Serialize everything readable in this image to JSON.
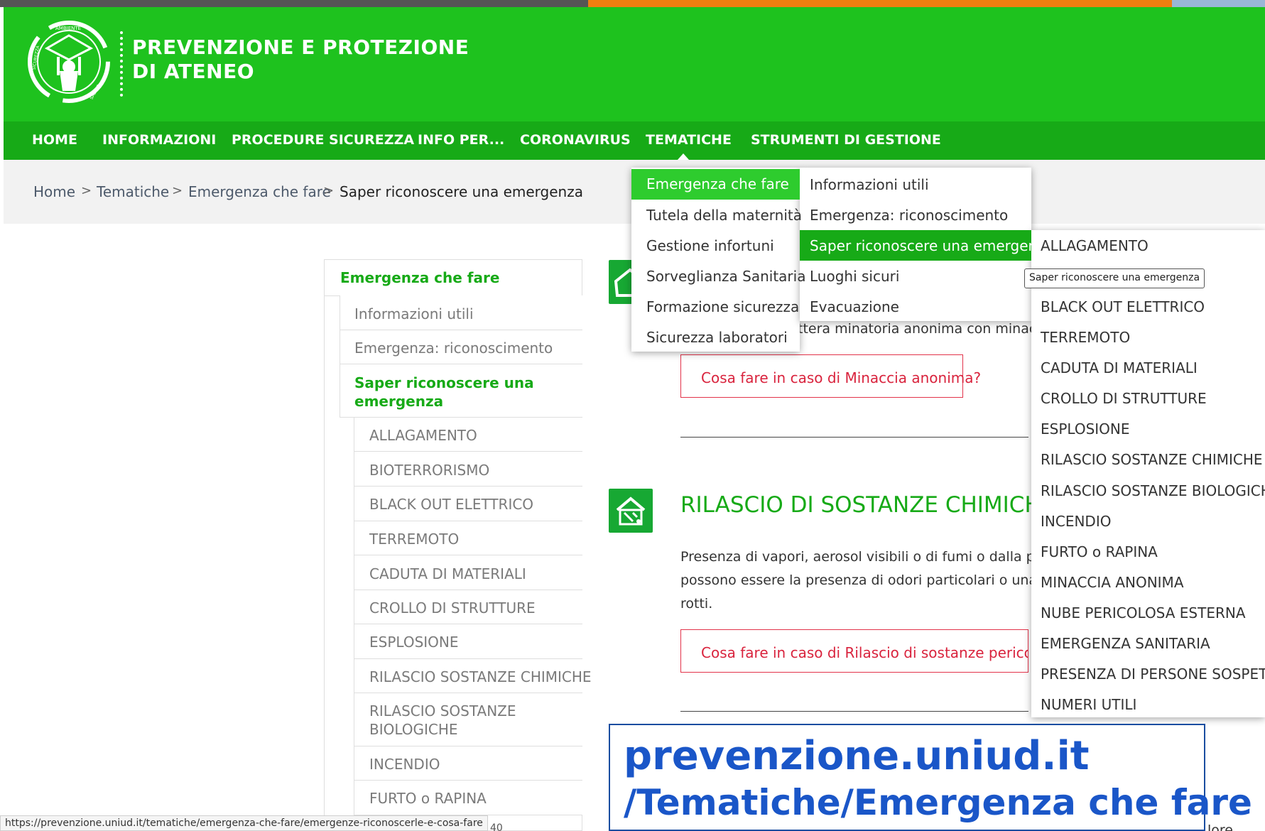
{
  "header": {
    "logo_ring_text": [
      "AMBIENTE",
      "SICUREZZA",
      "SALUTE"
    ],
    "title_line1": "PREVENZIONE E PROTEZIONE",
    "title_line2": "DI ATENEO"
  },
  "nav": {
    "items": [
      "HOME",
      "INFORMAZIONI",
      "PROCEDURE SICUREZZA",
      "INFO PER...",
      "CORONAVIRUS",
      "TEMATICHE",
      "STRUMENTI DI GESTIONE"
    ]
  },
  "breadcrumb": {
    "items": [
      "Home",
      "Tematiche",
      "Emergenza che fare",
      "Saper riconoscere una emergenza"
    ],
    "separator": ">"
  },
  "sidebar": {
    "heading": "Emergenza che fare",
    "level1": [
      "Informazioni utili",
      "Emergenza: riconoscimento"
    ],
    "active": [
      "Saper riconoscere una",
      "emergenza"
    ],
    "level2": [
      "ALLAGAMENTO",
      "BIOTERRORISMO",
      "BLACK OUT ELETTRICO",
      "TERREMOTO",
      "CADUTA DI MATERIALI",
      "CROLLO DI STRUTTURE",
      "ESPLOSIONE",
      "RILASCIO SOSTANZE CHIMICHE",
      "RILASCIO SOSTANZE",
      "BIOLOGICHE",
      "INCENDIO",
      "FURTO o RAPINA"
    ]
  },
  "content": {
    "minaccia_text": "ttera minatoria anonima con minaccia",
    "minaccia_button": "Cosa fare in caso di Minaccia anonima?",
    "section_title": "RILASCIO DI SOSTANZE CHIMICHE",
    "paragraph": [
      "Presenza di vapori, aerosol visibili o di fumi o dalla preser",
      "possono essere la presenza di odori particolari o una sen",
      "rotti."
    ],
    "rilascio_button": "Cosa fare in caso di Rilascio di sostanze pericolose?",
    "trailing_text": "lore"
  },
  "menu_tematiche": {
    "col1": [
      "Emergenza che fare",
      "Tutela della maternità",
      "Gestione infortuni",
      "Sorveglianza Sanitaria",
      "Formazione sicurezza",
      "Sicurezza laboratori"
    ],
    "col2": [
      "Informazioni utili",
      "Emergenza: riconoscimento",
      "Saper riconoscere una emergenza",
      "Luoghi sicuri",
      "Evacuazione"
    ],
    "col3": [
      "ALLAGAMENTO",
      "BLACK OUT ELETTRICO",
      "TERREMOTO",
      "CADUTA DI MATERIALI",
      "CROLLO DI STRUTTURE",
      "ESPLOSIONE",
      "RILASCIO SOSTANZE CHIMICHE",
      "RILASCIO SOSTANZE BIOLOGICHE",
      "INCENDIO",
      "FURTO o RAPINA",
      "MINACCIA ANONIMA",
      "NUBE PERICOLOSA ESTERNA",
      "EMERGENZA SANITARIA",
      "PRESENZA DI PERSONE SOSPETTE",
      "NUMERI UTILI"
    ]
  },
  "tooltip": "Saper riconoscere una emergenza",
  "overlay": {
    "line1": "prevenzione.uniud.it",
    "line2": "/Tematiche/Emergenza che fare"
  },
  "status_url": "https://prevenzione.uniud.it/tematiche/emergenza-che-fare/emergenze-riconoscerle-e-cosa-fare",
  "status_after": "40",
  "colors": {
    "header_green": "#1ec21e",
    "nav_green": "#17aa17",
    "selected_green": "#2ecc2e",
    "cta_red": "#d9233d",
    "overlay_blue": "#1a56c8"
  }
}
